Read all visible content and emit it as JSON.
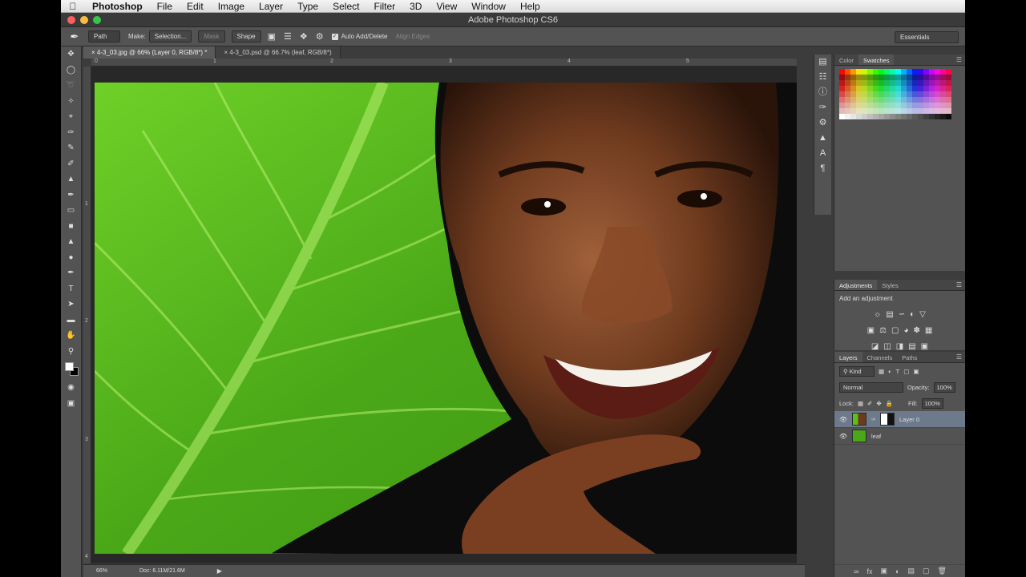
{
  "menubar": {
    "app_name": "Photoshop",
    "items": [
      "File",
      "Edit",
      "Image",
      "Layer",
      "Type",
      "Select",
      "Filter",
      "3D",
      "View",
      "Window",
      "Help"
    ]
  },
  "window": {
    "title": "Adobe Photoshop CS6"
  },
  "options_bar": {
    "mode_value": "Path",
    "make_label": "Make:",
    "selection_button": "Selection...",
    "mask_button": "Mask",
    "shape_button": "Shape",
    "auto_add_delete": "Auto Add/Delete",
    "auto_add_delete_checked": true,
    "align_edges": "Align Edges",
    "workspace": "Essentials"
  },
  "document_tabs": [
    {
      "label": "4-3_03.jpg @ 66% (Layer 0, RGB/8*) *",
      "active": true
    },
    {
      "label": "4-3_03.psd @ 66.7% (leaf, RGB/8*)",
      "active": false
    }
  ],
  "rulers": {
    "top": [
      "0",
      "1",
      "2",
      "3",
      "4",
      "5"
    ],
    "left": [
      "1",
      "2",
      "3",
      "4"
    ]
  },
  "status_bar": {
    "zoom": "66%",
    "doc": "Doc: 6.11M/21.6M"
  },
  "color_panel": {
    "tabs": [
      "Color",
      "Swatches"
    ],
    "active_tab": "Swatches"
  },
  "adjustments_panel": {
    "tabs": [
      "Adjustments",
      "Styles"
    ],
    "heading": "Add an adjustment"
  },
  "layers_panel": {
    "tabs": [
      "Layers",
      "Channels",
      "Paths"
    ],
    "filter": "Kind",
    "blend_mode": "Normal",
    "opacity_label": "Opacity:",
    "opacity": "100%",
    "lock_label": "Lock:",
    "fill_label": "Fill:",
    "fill": "100%",
    "layers": [
      {
        "name": "Layer 0",
        "selected": true
      },
      {
        "name": "leaf",
        "selected": false
      }
    ]
  },
  "colors": {
    "ui_bg": "#535353",
    "selection_blue": "#6d7a8c",
    "leaf_green": "#5bbf1e",
    "backdrop": "#000000"
  }
}
